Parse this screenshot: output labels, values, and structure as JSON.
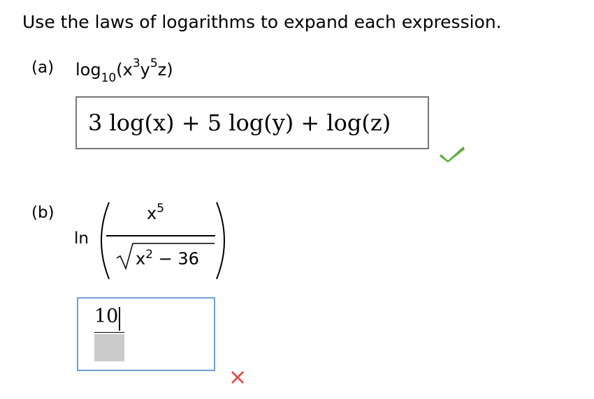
{
  "instructions": "Use the laws of logarithms to expand each expression.",
  "part_a": {
    "label": "(a)",
    "expression": {
      "func": "log",
      "base": "10",
      "open": "(x",
      "exp_x": "3",
      "var_y": "y",
      "exp_y": "5",
      "close": "z)"
    },
    "answer": "3 log(x) + 5 log(y) + log(z)",
    "status": "correct",
    "status_icon": "check-icon",
    "status_color": "#5cad3c"
  },
  "part_b": {
    "label": "(b)",
    "func": "ln",
    "numerator_base": "x",
    "numerator_exp": "5",
    "denominator_base": "x",
    "denominator_exp": "2",
    "denominator_rest": " − 36",
    "answer_value": "10",
    "status": "incorrect",
    "status_icon": "x-icon",
    "status_color": "#d9534f",
    "input_border_color": "#6f9fd3"
  }
}
